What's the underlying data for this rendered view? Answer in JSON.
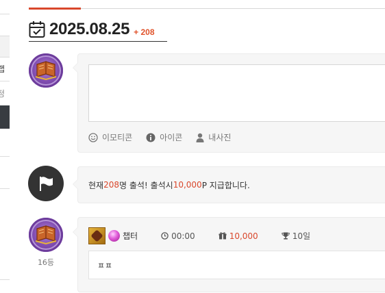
{
  "sidebar": {
    "fragment_1": "랩",
    "fragment_2": "정"
  },
  "header": {
    "date": "2025.08.25",
    "count": "+ 208"
  },
  "composer": {
    "textarea_placeholder": "",
    "tools": [
      {
        "label": "이모티콘",
        "icon": "smiley-icon"
      },
      {
        "label": "아이콘",
        "icon": "info-icon"
      },
      {
        "label": "내사진",
        "icon": "person-icon"
      }
    ]
  },
  "notice": {
    "prefix": "현재 ",
    "count": "208",
    "middle": "명 출석! 출석시 ",
    "points": "10,000",
    "suffix": "P 지급합니다."
  },
  "entry": {
    "nickname": "챕터",
    "time": "00:00",
    "points": "10,000",
    "days": "10일",
    "message": "ㅍㅍ",
    "rank": "16등"
  },
  "colors": {
    "accent": "#d9472b",
    "dark_avatar": "#333333"
  }
}
